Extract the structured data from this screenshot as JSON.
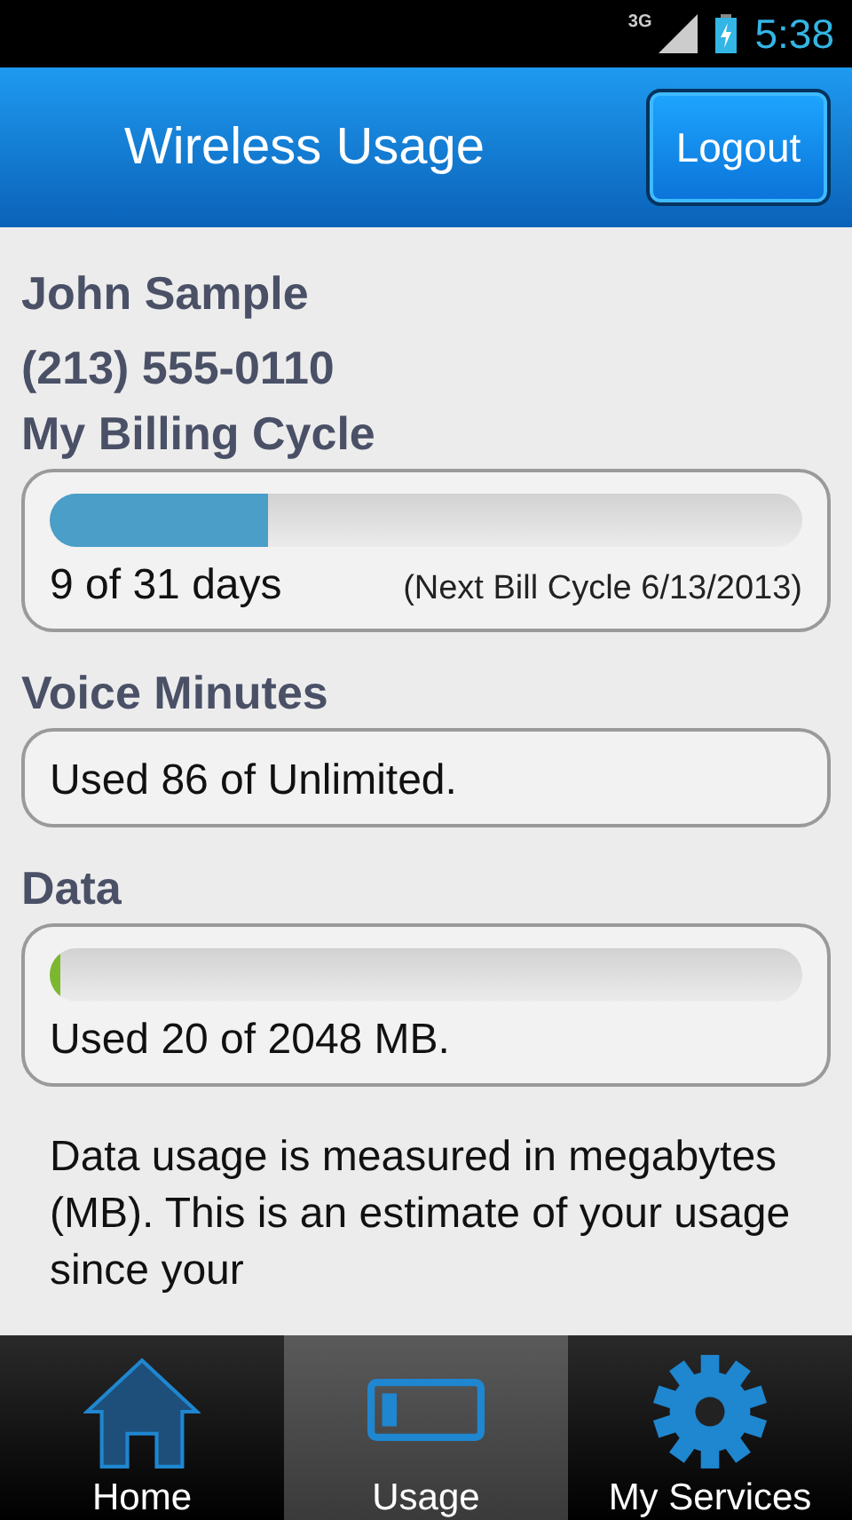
{
  "status_bar": {
    "network": "3G",
    "time": "5:38"
  },
  "header": {
    "title": "Wireless Usage",
    "button": "Logout"
  },
  "account": {
    "name": "John Sample",
    "phone": "(213) 555-0110"
  },
  "sections": [
    {
      "kind": "meter",
      "title": "My Billing Cycle",
      "level": 0.29,
      "color": "#4a9ec8",
      "reading": "9 of 31 days",
      "note": "(Next Bill Cycle 6/13/2013)"
    },
    {
      "kind": "text",
      "title": "Voice Minutes",
      "reading": "Used 86 of Unlimited."
    },
    {
      "kind": "meter",
      "title": "Data",
      "level": 0.01,
      "color": "#7cb82f",
      "reading": "Used 20 of 2048 MB."
    }
  ],
  "info": "Data usage is measured in megabytes (MB). This is an estimate of your usage since your",
  "tabs": [
    {
      "kind": "home",
      "label": "Home",
      "selected": false
    },
    {
      "kind": "usage",
      "label": "Usage",
      "selected": true
    },
    {
      "kind": "services",
      "label": "My Services",
      "selected": false
    }
  ]
}
